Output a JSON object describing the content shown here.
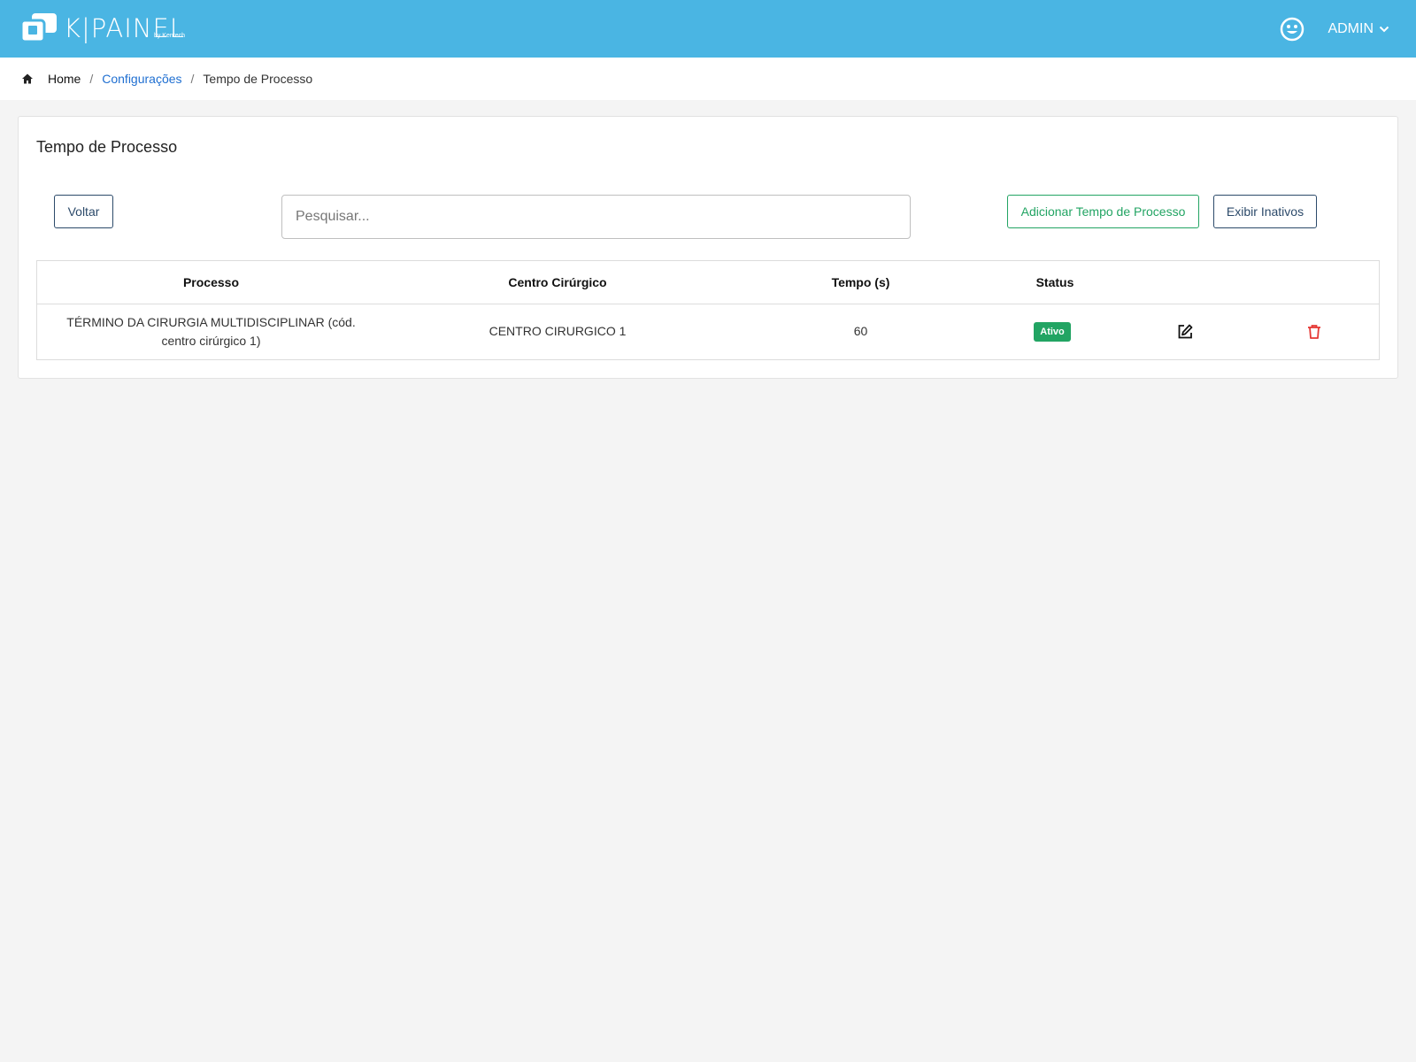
{
  "header": {
    "logo_text": "K|PAINEL",
    "logo_by": "by Kentech",
    "user_name": "ADMIN",
    "icons": [
      "smiley-icon",
      "chevron-down-icon"
    ],
    "color": "#4ab5e3"
  },
  "breadcrumb": {
    "home": "Home",
    "sep1": "/",
    "configuracoes": "Configurações",
    "sep2": "/",
    "current": "Tempo de Processo"
  },
  "page": {
    "title": "Tempo de Processo",
    "back_button": "Voltar",
    "search_placeholder": "Pesquisar...",
    "add_button": "Adicionar Tempo de Processo",
    "show_inactive_button": "Exibir Inativos"
  },
  "table": {
    "columns": [
      "Processo",
      "Centro Cirúrgico",
      "Tempo (s)",
      "Status"
    ],
    "rows": [
      {
        "processo": "TÉRMINO DA CIRURGIA MULTIDISCIPLINAR (cód. centro cirúrgico 1)",
        "centro": "CENTRO CIRURGICO 1",
        "tempo": "60",
        "status": "Ativo",
        "status_color": "#22a463",
        "actions": [
          "edit-icon",
          "trash-icon"
        ]
      }
    ]
  }
}
